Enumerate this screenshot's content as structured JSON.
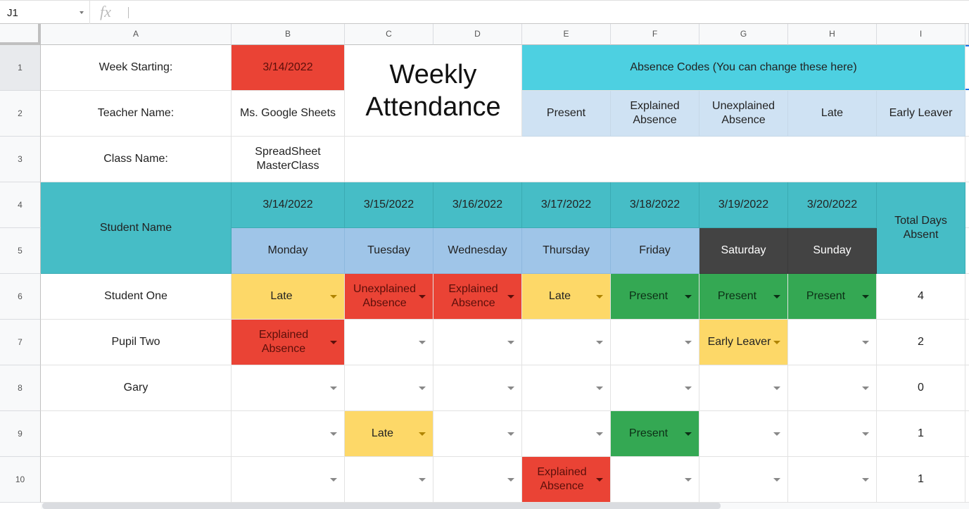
{
  "formula_bar": {
    "cell_ref": "J1",
    "fx_label": "fx",
    "formula": ""
  },
  "columns": [
    "A",
    "B",
    "C",
    "D",
    "E",
    "F",
    "G",
    "H",
    "I"
  ],
  "rows": [
    "1",
    "2",
    "3",
    "4",
    "5",
    "6",
    "7",
    "8",
    "9",
    "10"
  ],
  "header": {
    "week_starting_label": "Week Starting:",
    "week_starting_value": "3/14/2022",
    "teacher_label": "Teacher Name:",
    "teacher_value": "Ms. Google Sheets",
    "class_label": "Class Name:",
    "class_value": "SpreadSheet MasterClass",
    "title": "Weekly Attendance",
    "codes_title": "Absence Codes (You can change these here)",
    "codes": [
      "Present",
      "Explained Absence",
      "Unexplained Absence",
      "Late",
      "Early Leaver"
    ]
  },
  "table": {
    "student_name_header": "Student Name",
    "total_header": "Total Days Absent",
    "dates": [
      "3/14/2022",
      "3/15/2022",
      "3/16/2022",
      "3/17/2022",
      "3/18/2022",
      "3/19/2022",
      "3/20/2022"
    ],
    "days": [
      "Monday",
      "Tuesday",
      "Wednesday",
      "Thursday",
      "Friday",
      "Saturday",
      "Sunday"
    ],
    "students": [
      {
        "name": "Student One",
        "marks": [
          "Late",
          "Unexplained Absence",
          "Explained Absence",
          "Late",
          "Present",
          "Present",
          "Present"
        ],
        "total": "4"
      },
      {
        "name": "Pupil Two",
        "marks": [
          "Explained Absence",
          "",
          "",
          "",
          "",
          "Early Leaver",
          ""
        ],
        "total": "2"
      },
      {
        "name": "Gary",
        "marks": [
          "",
          "",
          "",
          "",
          "",
          "",
          ""
        ],
        "total": "0"
      },
      {
        "name": "",
        "marks": [
          "",
          "Late",
          "",
          "",
          "Present",
          "",
          ""
        ],
        "total": "1"
      },
      {
        "name": "",
        "marks": [
          "",
          "",
          "",
          "Explained Absence",
          "",
          "",
          ""
        ],
        "total": "1"
      }
    ]
  },
  "colors": {
    "present": "#34a853",
    "explained": "#ea4335",
    "unexplained": "#ea4335",
    "late": "#fdd868",
    "early_leaver": "#fdd868",
    "week_start": "#ea4335",
    "header_teal": "#46bdc6",
    "codes_cyan": "#4dd0e1",
    "weekend_dark": "#434343"
  }
}
